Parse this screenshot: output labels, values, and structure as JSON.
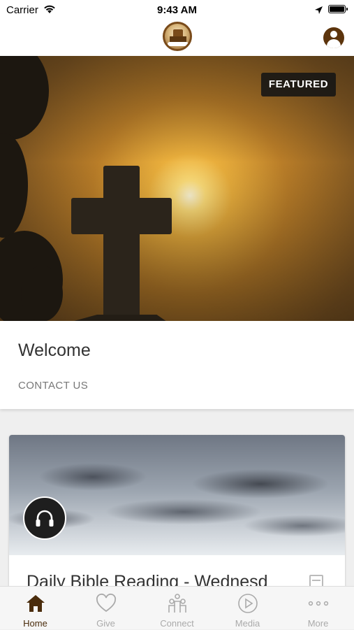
{
  "status_bar": {
    "carrier": "Carrier",
    "time": "9:43 AM"
  },
  "hero": {
    "badge": "FEATURED"
  },
  "welcome": {
    "title": "Welcome",
    "link": "CONTACT US"
  },
  "media_card": {
    "title": "Daily Bible Reading - Wednesd"
  },
  "tabs": [
    {
      "label": "Home",
      "icon": "home-icon",
      "active": true
    },
    {
      "label": "Give",
      "icon": "heart-icon",
      "active": false
    },
    {
      "label": "Connect",
      "icon": "people-icon",
      "active": false
    },
    {
      "label": "Media",
      "icon": "play-icon",
      "active": false
    },
    {
      "label": "More",
      "icon": "more-icon",
      "active": false
    }
  ],
  "colors": {
    "brand": "#4a2c0c",
    "inactive": "#aaaaaa"
  }
}
